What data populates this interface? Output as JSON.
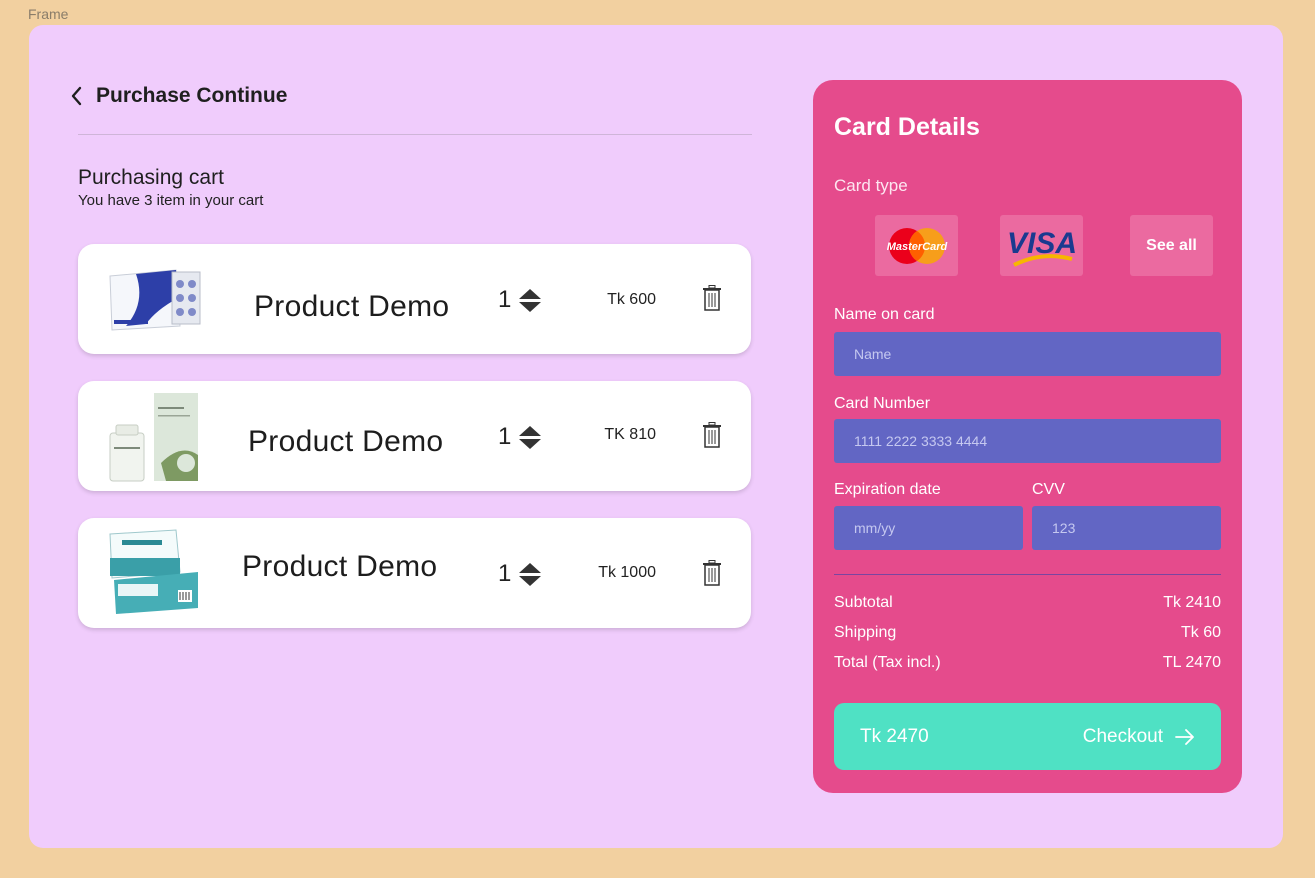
{
  "frame_label": "Frame",
  "header": {
    "title": "Purchase Continue"
  },
  "cart": {
    "title": "Purchasing cart",
    "subtitle": "You have 3 item in your cart",
    "items": [
      {
        "name": "Product Demo",
        "qty": "1",
        "price": "Tk 600"
      },
      {
        "name": "Product Demo",
        "qty": "1",
        "price": "TK 810"
      },
      {
        "name": "Product Demo",
        "qty": "1",
        "price": "Tk 1000"
      }
    ]
  },
  "card_details": {
    "title": "Card Details",
    "card_type_label": "Card type",
    "card_types": [
      "MasterCard",
      "VISA"
    ],
    "see_all_label": "See all",
    "name_label": "Name on card",
    "name_placeholder": "Name",
    "number_label": "Card Number",
    "number_placeholder": "1111 2222 3333 4444",
    "expiry_label": "Expiration date",
    "expiry_placeholder": "mm/yy",
    "cvv_label": "CVV",
    "cvv_placeholder": "123"
  },
  "summary": {
    "subtotal_label": "Subtotal",
    "subtotal_value": "Tk 2410",
    "shipping_label": "Shipping",
    "shipping_value": "Tk 60",
    "total_label": "Total (Tax incl.)",
    "total_value": "TL 2470"
  },
  "checkout": {
    "amount": "Tk 2470",
    "label": "Checkout"
  },
  "colors": {
    "background": "#f2d0a0",
    "frame": "#f0ccfc",
    "panel": "#e54b8c",
    "field": "#6266c4",
    "checkout": "#4fe1c4"
  }
}
